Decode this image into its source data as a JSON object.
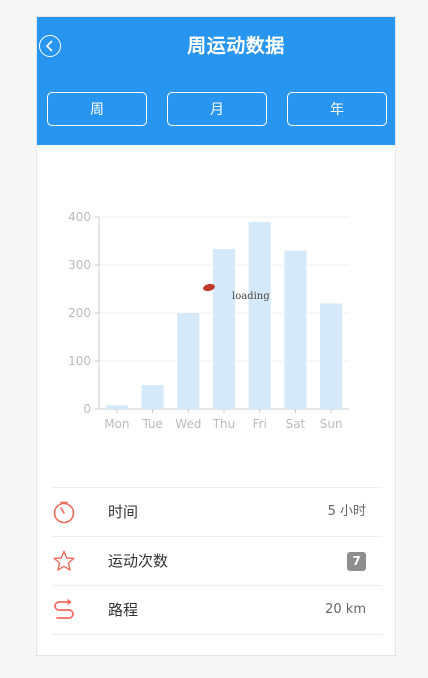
{
  "header": {
    "title": "周运动数据",
    "background": "#2896f0",
    "tabs": [
      {
        "label": "周"
      },
      {
        "label": "月"
      },
      {
        "label": "年"
      }
    ]
  },
  "chart_data": {
    "type": "bar",
    "categories": [
      "Mon",
      "Tue",
      "Wed",
      "Thu",
      "Fri",
      "Sat",
      "Sun"
    ],
    "values": [
      8,
      50,
      200,
      333,
      390,
      330,
      220
    ],
    "ylim": [
      0,
      400
    ],
    "yticks": [
      0,
      100,
      200,
      300,
      400
    ],
    "grid": true,
    "bar_color": "#d6e9f8"
  },
  "loading": {
    "text": "loading"
  },
  "stats": [
    {
      "icon": "timer-icon",
      "label": "时间",
      "value": "5 小时"
    },
    {
      "icon": "star-icon",
      "label": "运动次数",
      "value": "7"
    },
    {
      "icon": "route-icon",
      "label": "路程",
      "value": "20 km"
    }
  ],
  "colors": {
    "icon": "#f06a5c",
    "badge": "#8e8e8e"
  }
}
